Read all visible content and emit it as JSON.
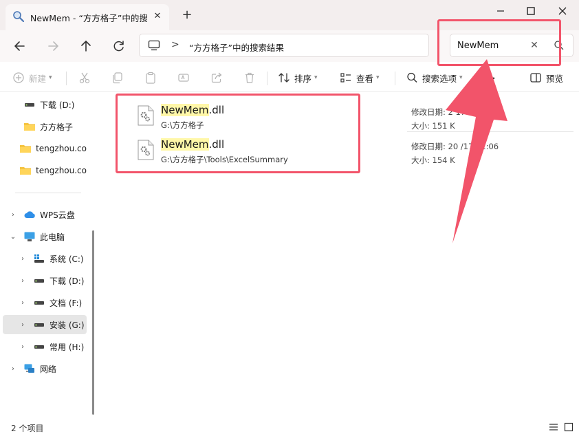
{
  "window": {
    "tab_title": "NewMem - “方方格子”中的搜索",
    "tab_close": "✕",
    "new_tab": "+"
  },
  "address": {
    "separator": ">",
    "path": "“方方格子”中的搜索结果"
  },
  "search": {
    "value": "NewMem",
    "clear": "✕"
  },
  "toolbar": {
    "new_label": "新建",
    "sort_label": "排序",
    "view_label": "查看",
    "search_options_label": "搜索选项",
    "more_label": "···",
    "preview_label": "预览"
  },
  "sidebar": {
    "items": [
      {
        "label": "下载 (D:)",
        "icon": "drive-icon"
      },
      {
        "label": "方方格子",
        "icon": "folder-icon"
      },
      {
        "label": "tengzhou.co",
        "icon": "folder-icon"
      },
      {
        "label": "tengzhou.co",
        "icon": "folder-icon"
      },
      {
        "label": "WPS云盘",
        "icon": "cloud-icon"
      },
      {
        "label": "此电脑",
        "icon": "pc-icon"
      },
      {
        "label": "系统 (C:)",
        "icon": "windows-drive-icon"
      },
      {
        "label": "下载 (D:)",
        "icon": "drive-icon"
      },
      {
        "label": "文档 (F:)",
        "icon": "drive-icon"
      },
      {
        "label": "安装 (G:)",
        "icon": "drive-icon"
      },
      {
        "label": "常用 (H:)",
        "icon": "drive-icon"
      },
      {
        "label": "网络",
        "icon": "network-icon"
      }
    ]
  },
  "results": [
    {
      "name_highlight": "NewMem",
      "name_rest": ".dll",
      "path": "G:\\方方格子",
      "modified": "修改日期: 2                    17:10",
      "size": "大小: 151 K"
    },
    {
      "name_highlight": "NewMem",
      "name_rest": ".dll",
      "path": "G:\\方方格子\\Tools\\ExcelSummary",
      "modified": "修改日期: 20          /17 11:06",
      "size": "大小: 154 K"
    }
  ],
  "status": {
    "count": "2 个项目"
  },
  "colors": {
    "annotation": "#f2546a",
    "highlight": "#fff7a8"
  }
}
